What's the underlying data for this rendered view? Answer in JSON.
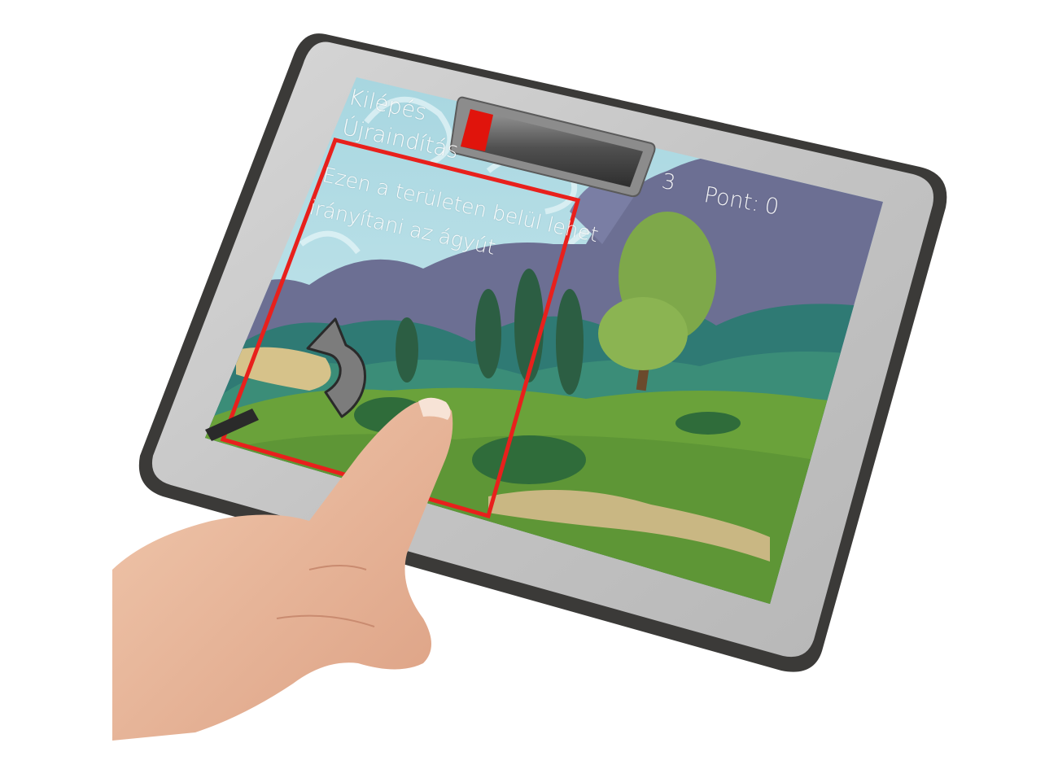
{
  "menu": {
    "exit_label": "Kilépés",
    "restart_label": "Újraindítás"
  },
  "hint": {
    "line1": "Ezen a területen belül lehet",
    "line2": "irányítani az ágyút"
  },
  "hud": {
    "ammo_count": "3",
    "score_label": "Pont:",
    "score_value": "0",
    "power_level": 0.1
  },
  "colors": {
    "control_zone_border": "#e8201c",
    "power_fill": "#e0140c",
    "sky": "#bfe3ea",
    "mountains": "#6c6f93",
    "grass": "#6aa23a"
  },
  "icons": {
    "rotate": "curved-arrow-rotate-icon",
    "cannon": "cannon-icon"
  }
}
